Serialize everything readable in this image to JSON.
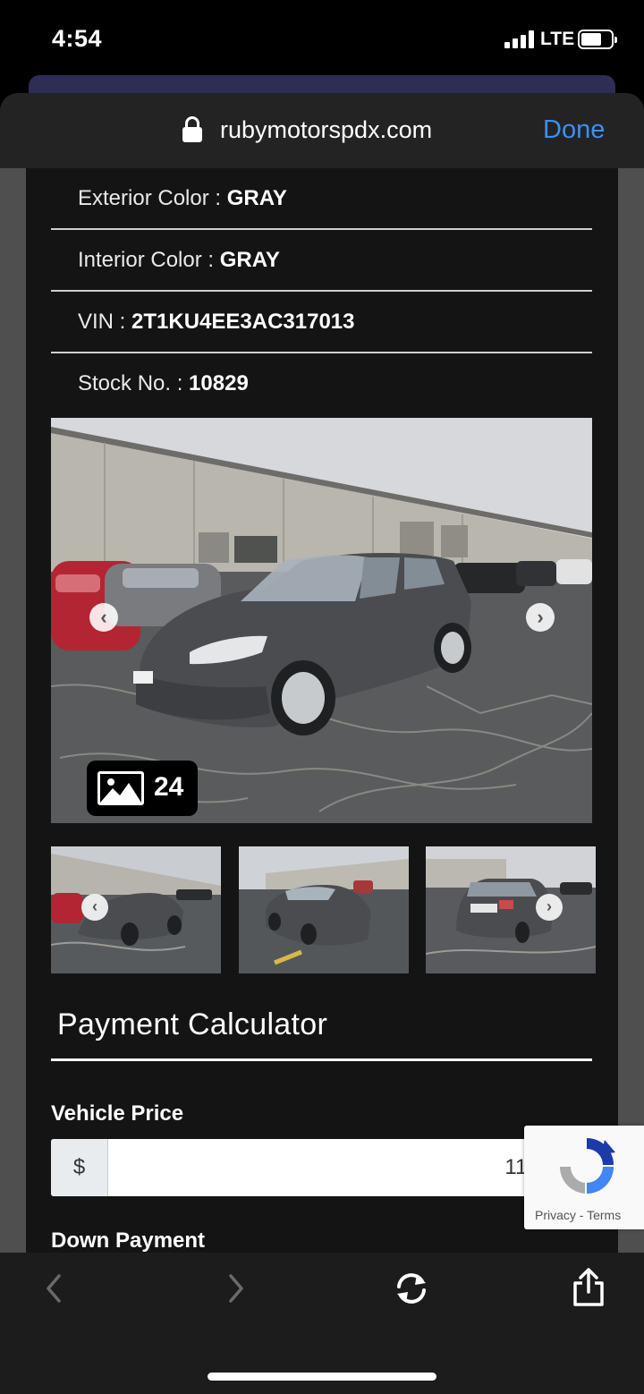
{
  "status_bar": {
    "time": "4:54",
    "network": "LTE"
  },
  "browser": {
    "url": "rubymotorspdx.com",
    "done_label": "Done"
  },
  "specs": [
    {
      "label": "Exterior Color : ",
      "value": "GRAY"
    },
    {
      "label": "Interior Color : ",
      "value": "GRAY"
    },
    {
      "label": "VIN : ",
      "value": "2T1KU4EE3AC317013"
    },
    {
      "label": "Stock No. : ",
      "value": "10829"
    }
  ],
  "gallery": {
    "photo_count": "24"
  },
  "calculator": {
    "title": "Payment Calculator",
    "vehicle_price_label": "Vehicle Price",
    "currency_symbol": "$",
    "vehicle_price_value": "11,999",
    "down_payment_label": "Down Payment"
  },
  "recaptcha": {
    "privacy": "Privacy",
    "separator": " - ",
    "terms": "Terms"
  },
  "colors": {
    "accent": "#3d8ff5",
    "page_bg": "#141414",
    "sheet_header": "#232323"
  }
}
